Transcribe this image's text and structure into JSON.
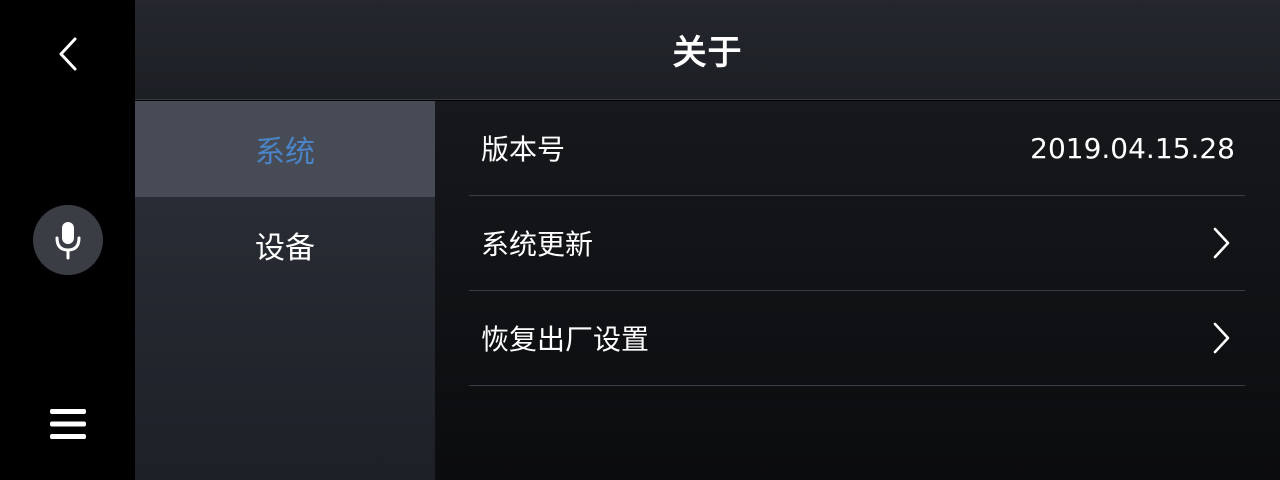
{
  "header": {
    "title": "关于"
  },
  "rail": {
    "back_icon": "chevron-left-icon",
    "mic_icon": "microphone-icon",
    "menu_icon": "hamburger-menu-icon"
  },
  "categories": [
    {
      "label": "系统",
      "active": true
    },
    {
      "label": "设备",
      "active": false
    }
  ],
  "rows": [
    {
      "label": "版本号",
      "value": "2019.04.15.28"
    },
    {
      "label": "系统更新",
      "icon": "chevron-right-icon"
    },
    {
      "label": "恢复出厂设置",
      "icon": "chevron-right-icon"
    }
  ],
  "colors": {
    "accent": "#4a84c6",
    "active_bg": "#474b55",
    "divider": "#3a3d43"
  }
}
